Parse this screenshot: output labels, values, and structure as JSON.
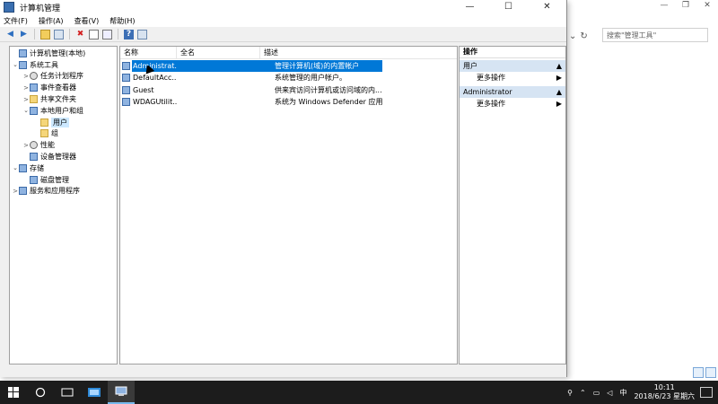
{
  "window": {
    "title": "计算机管理",
    "controls": [
      "—",
      "☐",
      "✕"
    ]
  },
  "menu": [
    "文件(F)",
    "操作(A)",
    "查看(V)",
    "帮助(H)"
  ],
  "background_window": {
    "search_placeholder": "搜索\"管理工具\"",
    "controls": [
      "—",
      "❐",
      "✕"
    ],
    "dropdown": "⌄",
    "refresh": "↻"
  },
  "tree": [
    {
      "label": "计算机管理(本地)",
      "level": 0,
      "arrow": "",
      "icon": "computer-icon"
    },
    {
      "label": "系统工具",
      "level": 0,
      "arrow": "⌄",
      "icon": "tools-icon"
    },
    {
      "label": "任务计划程序",
      "level": 1,
      "arrow": ">",
      "icon": "clock-icon"
    },
    {
      "label": "事件查看器",
      "level": 1,
      "arrow": ">",
      "icon": "event-viewer-icon"
    },
    {
      "label": "共享文件夹",
      "level": 1,
      "arrow": ">",
      "icon": "shared-folder-icon"
    },
    {
      "label": "本地用户和组",
      "level": 1,
      "arrow": "⌄",
      "icon": "users-groups-icon"
    },
    {
      "label": "用户",
      "level": 2,
      "arrow": "",
      "icon": "folder-icon",
      "selected": true
    },
    {
      "label": "组",
      "level": 2,
      "arrow": "",
      "icon": "folder-icon"
    },
    {
      "label": "性能",
      "level": 1,
      "arrow": ">",
      "icon": "performance-icon"
    },
    {
      "label": "设备管理器",
      "level": 1,
      "arrow": "",
      "icon": "device-manager-icon"
    },
    {
      "label": "存储",
      "level": 0,
      "arrow": "⌄",
      "icon": "storage-icon"
    },
    {
      "label": "磁盘管理",
      "level": 1,
      "arrow": "",
      "icon": "disk-icon"
    },
    {
      "label": "服务和应用程序",
      "level": 0,
      "arrow": ">",
      "icon": "services-icon"
    }
  ],
  "columns": [
    "名称",
    "全名",
    "描述"
  ],
  "users": [
    {
      "name": "Administrat...",
      "fullname": "",
      "desc": "管理计算机(域)的内置帐户",
      "selected": true
    },
    {
      "name": "DefaultAcc...",
      "fullname": "",
      "desc": "系统管理的用户帐户。"
    },
    {
      "name": "Guest",
      "fullname": "",
      "desc": "供来宾访问计算机或访问域的内..."
    },
    {
      "name": "WDAGUtilit...",
      "fullname": "",
      "desc": "系统为 Windows Defender 应用..."
    }
  ],
  "actions": {
    "header": "操作",
    "sections": [
      {
        "title": "用户",
        "items": [
          "更多操作"
        ]
      },
      {
        "title": "Administrator",
        "items": [
          "更多操作"
        ]
      }
    ]
  },
  "taskbar": {
    "time": "10:11",
    "date": "2018/6/23 星期六",
    "ime": "中"
  }
}
